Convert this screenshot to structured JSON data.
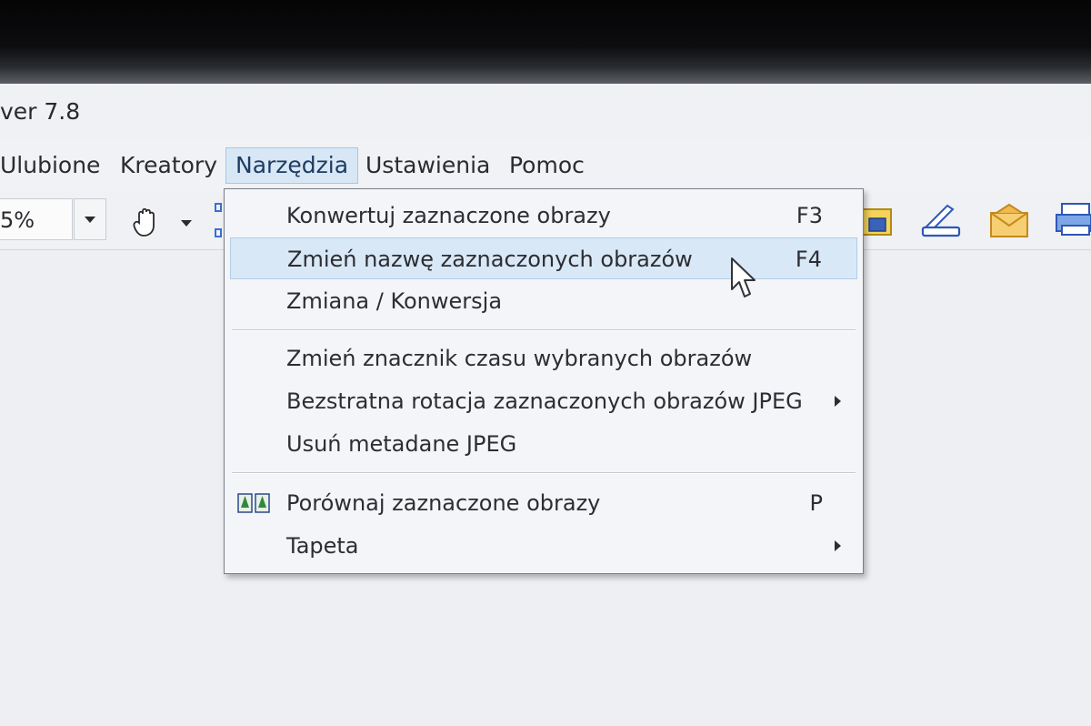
{
  "window": {
    "title": "ver 7.8"
  },
  "menubar": {
    "items": [
      {
        "label": "Ulubione"
      },
      {
        "label": "Kreatory"
      },
      {
        "label": "Narzędzia",
        "active": true
      },
      {
        "label": "Ustawienia"
      },
      {
        "label": "Pomoc"
      }
    ]
  },
  "toolbar": {
    "zoom_value": "5%",
    "icons": [
      "hand-pan-icon",
      "slideshow-icon",
      "scanner-icon",
      "email-icon",
      "printer-icon"
    ]
  },
  "dropdown": {
    "items": [
      {
        "label": "Konwertuj zaznaczone obrazy",
        "shortcut": "F3"
      },
      {
        "label": "Zmień nazwę zaznaczonych obrazów",
        "shortcut": "F4",
        "highlighted": true
      },
      {
        "label": "Zmiana / Konwersja"
      },
      {
        "label": "Zmień znacznik czasu wybranych obrazów"
      },
      {
        "label": "Bezstratna rotacja zaznaczonych obrazów JPEG",
        "submenu": true
      },
      {
        "label": "Usuń metadane JPEG"
      },
      {
        "label": "Porównaj zaznaczone obrazy",
        "shortcut": "P",
        "icon": "compare-trees-icon"
      },
      {
        "label": "Tapeta",
        "submenu": true
      }
    ]
  },
  "colors": {
    "menu_highlight": "#d9e8f6",
    "menu_highlight_border": "#b2cde7",
    "active_menu_bg": "#d7e7f5",
    "background": "#eeeff3"
  }
}
